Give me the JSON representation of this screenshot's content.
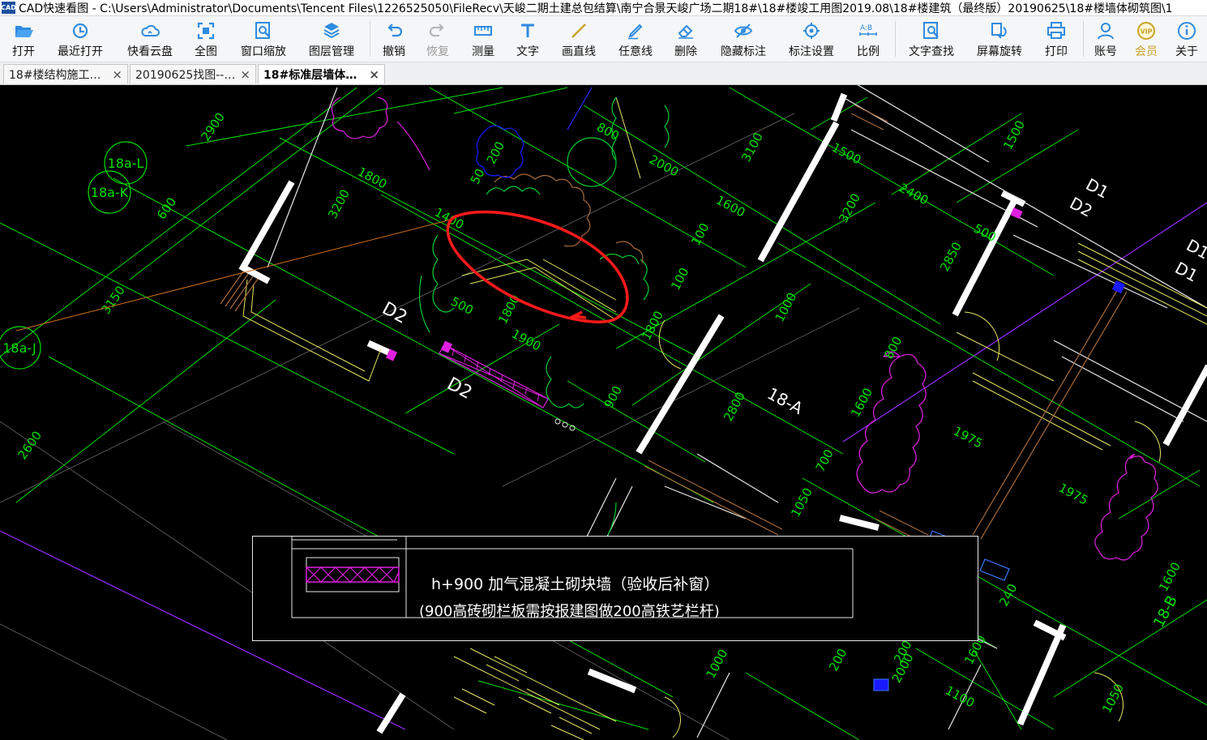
{
  "window": {
    "app_icon_text": "CAD",
    "title": "CAD快速看图 - C:\\Users\\Administrator\\Documents\\Tencent Files\\1226525050\\FileRecv\\天峻二期土建总包结算\\南宁合景天峻广场二期18#\\18#楼竣工用图2019.08\\18#楼建筑（最终版）20190625\\18#楼墙体砌筑图\\1"
  },
  "toolbar": {
    "items": [
      {
        "label": "打开",
        "icon": "folder-open-icon"
      },
      {
        "label": "最近打开",
        "icon": "recent-clock-icon"
      },
      {
        "label": "快看云盘",
        "icon": "cloud-icon"
      },
      {
        "label": "全图",
        "icon": "fit-all-icon"
      },
      {
        "label": "窗口缩放",
        "icon": "window-zoom-icon"
      },
      {
        "label": "图层管理",
        "icon": "layers-icon"
      },
      {
        "label": "撤销",
        "icon": "undo-icon"
      },
      {
        "label": "恢复",
        "icon": "redo-icon"
      },
      {
        "label": "测量",
        "icon": "ruler-icon"
      },
      {
        "label": "文字",
        "icon": "text-icon"
      },
      {
        "label": "画直线",
        "icon": "line-icon"
      },
      {
        "label": "任意线",
        "icon": "freehand-pen-icon"
      },
      {
        "label": "删除",
        "icon": "eraser-icon"
      },
      {
        "label": "隐藏标注",
        "icon": "hide-eye-icon"
      },
      {
        "label": "标注设置",
        "icon": "annotation-settings-icon"
      },
      {
        "label": "比例",
        "icon": "scale-icon"
      },
      {
        "label": "文字查找",
        "icon": "text-search-icon"
      },
      {
        "label": "屏幕旋转",
        "icon": "screen-rotate-icon"
      },
      {
        "label": "打印",
        "icon": "printer-icon"
      },
      {
        "label": "账号",
        "icon": "account-user-icon"
      },
      {
        "label": "会员",
        "icon": "vip-icon"
      },
      {
        "label": "关于",
        "icon": "info-icon"
      }
    ],
    "vip_badge": "VIP"
  },
  "tabs": [
    {
      "label": "18#楼结构施工…",
      "active": false,
      "close": "×"
    },
    {
      "label": "20190625找图--…",
      "active": false,
      "close": "×"
    },
    {
      "label": "18#标准层墙体…",
      "active": true,
      "close": "×"
    }
  ],
  "colors": {
    "canvas_bg": "#000000",
    "dimension_green": "#00e000",
    "wall_white": "#ffffff",
    "plant_green": "#00cc33",
    "plant_magenta": "#e020e0",
    "axis_purple": "#9a2cff",
    "redline": "#ff1a1a",
    "hatch_brown": "#a86a3a",
    "detail_yellow": "#e8e860"
  },
  "drawing": {
    "axis_bubbles": [
      "18a-L",
      "18a-K",
      "18a-J"
    ],
    "room_labels": [
      "18-A",
      "18-B"
    ],
    "tags": [
      "D1",
      "D2",
      "D1",
      "D1",
      "D2",
      "D2"
    ],
    "dimensions": [
      "2900",
      "600",
      "3150",
      "2600",
      "1800",
      "3200",
      "1400",
      "500",
      "1800",
      "1900",
      "50",
      "200",
      "800",
      "100",
      "1000",
      "2000",
      "3100",
      "1600",
      "100",
      "1800",
      "900",
      "2800",
      "1500",
      "3200",
      "2400",
      "1500",
      "500",
      "2850",
      "800",
      "1600",
      "1975",
      "1975",
      "1000",
      "700",
      "1050",
      "200",
      "2000",
      "1100",
      "1600",
      "1600",
      "200",
      "1050",
      "240"
    ]
  },
  "legend": {
    "line1": "h+900 加气混凝土砌块墙（验收后补窗）",
    "line2": "(900高砖砌栏板需按报建图做200高铁艺栏杆)"
  }
}
